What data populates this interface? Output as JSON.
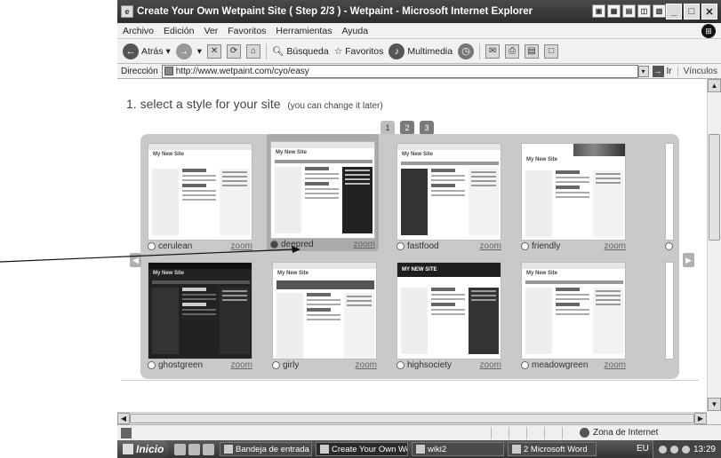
{
  "window": {
    "title": "Create Your Own Wetpaint Site ( Step 2/3 ) - Wetpaint - Microsoft Internet Explorer",
    "controls": [
      "_",
      "□",
      "✕"
    ]
  },
  "menubar": {
    "items": [
      "Archivo",
      "Edición",
      "Ver",
      "Favoritos",
      "Herramientas",
      "Ayuda"
    ]
  },
  "toolbar": {
    "back_label": "Atrás",
    "search_label": "Búsqueda",
    "favorites_label": "Favoritos",
    "media_label": "Multimedia"
  },
  "address": {
    "label": "Dirección",
    "url": "http://www.wetpaint.com/cyo/easy",
    "go_label": "Ir",
    "links_label": "Vínculos"
  },
  "page": {
    "heading": "1. select a style for your site",
    "subheading": "(you can change it later)",
    "pages": [
      "1",
      "2",
      "3"
    ],
    "active_page": "1",
    "thumb_title": "My New Site",
    "thumb_title_hs": "MY NEW SITE",
    "zoom_label": "zoom",
    "styles": [
      {
        "name": "cerulean",
        "selected": false
      },
      {
        "name": "deepred",
        "selected": true
      },
      {
        "name": "fastfood",
        "selected": false
      },
      {
        "name": "friendly",
        "selected": false
      },
      {
        "name": "ghostgreen",
        "selected": false
      },
      {
        "name": "girly",
        "selected": false
      },
      {
        "name": "highsociety",
        "selected": false
      },
      {
        "name": "meadowgreen",
        "selected": false
      }
    ]
  },
  "statusbar": {
    "zone": "Zona de Internet"
  },
  "taskbar": {
    "start_label": "Inicio",
    "tasks": [
      "Bandeja de entrada -...",
      "Create Your Own We...",
      "wiki2",
      "2 Microsoft Word"
    ],
    "language": "EU",
    "time": "13:29"
  }
}
